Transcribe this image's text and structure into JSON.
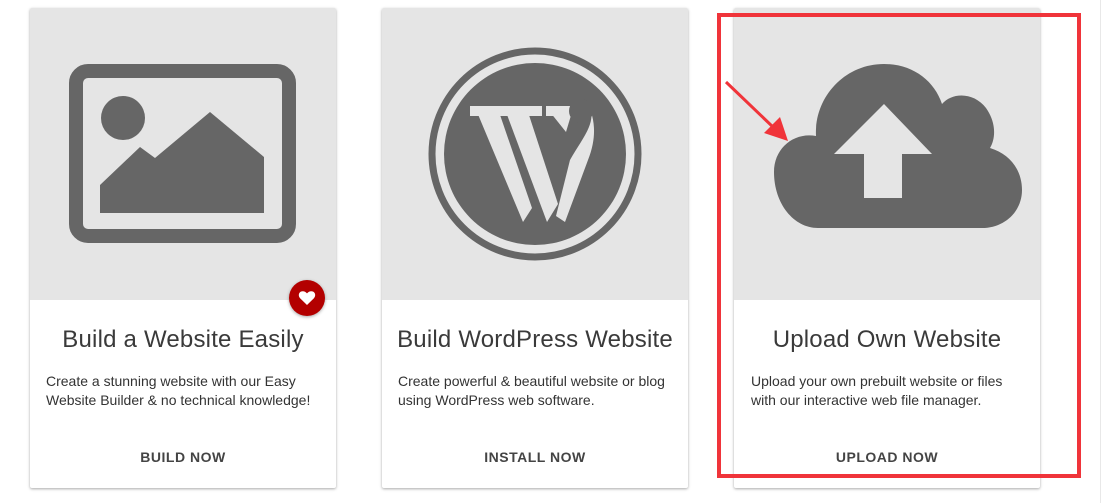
{
  "cards": [
    {
      "title": "Build a Website Easily",
      "description": "Create a stunning website with our Easy Website Builder & no technical knowledge!",
      "action": "BUILD NOW",
      "icon": "image-icon",
      "favorite_icon": "heart-icon"
    },
    {
      "title": "Build WordPress Website",
      "description": "Create powerful & beautiful website or blog using WordPress web software.",
      "action": "INSTALL NOW",
      "icon": "wordpress-icon"
    },
    {
      "title": "Upload Own Website",
      "description": "Upload your own prebuilt website or files with our interactive web file manager.",
      "action": "UPLOAD NOW",
      "icon": "cloud-upload-icon"
    }
  ],
  "colors": {
    "icon_gray": "#666666",
    "media_bg": "#e5e5e5",
    "favorite_red": "#b30000",
    "annotation_red": "#f0343a"
  }
}
